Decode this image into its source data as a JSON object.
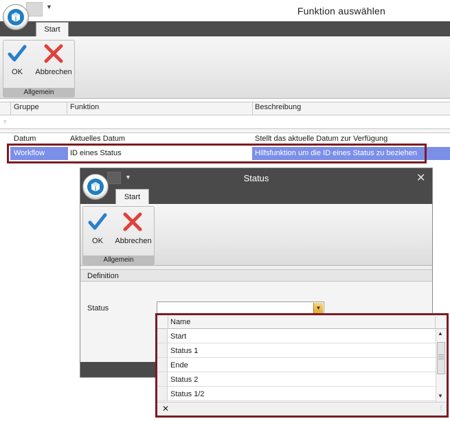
{
  "main_window": {
    "title": "Funktion auswählen",
    "tab_start": "Start",
    "ribbon": {
      "ok_label": "OK",
      "cancel_label": "Abbrechen",
      "group_label": "Allgemein"
    },
    "grid": {
      "columns": [
        "Gruppe",
        "Funktion",
        "Beschreibung"
      ],
      "rows": [
        {
          "gruppe": "Datum",
          "funktion": "Aktuelles Datum",
          "beschreibung": "Stellt das aktuelle Datum zur Verfügung"
        },
        {
          "gruppe": "Workflow",
          "funktion": "ID eines Status",
          "beschreibung": "Hilfsfunktion um die ID eines Status zu beziehen"
        }
      ],
      "selected_row_index": 1
    }
  },
  "dialog": {
    "title": "Status",
    "close_glyph": "✕",
    "tab_start": "Start",
    "ribbon": {
      "ok_label": "OK",
      "cancel_label": "Abbrechen",
      "group_label": "Allgemein"
    },
    "section_label": "Definition",
    "status_label": "Status",
    "status_value": "",
    "dropdown": {
      "column_header": "Name",
      "items": [
        "Start",
        "Status 1",
        "Ende",
        "Status 2",
        "Status 1/2"
      ],
      "close_glyph": "✕"
    }
  },
  "colors": {
    "selection": "#7b8fe8",
    "highlight_outline": "#7b1b22",
    "titlebar_dark": "#4a4a4a",
    "ok_blue": "#2a7fc9",
    "cancel_red": "#e0403a"
  }
}
